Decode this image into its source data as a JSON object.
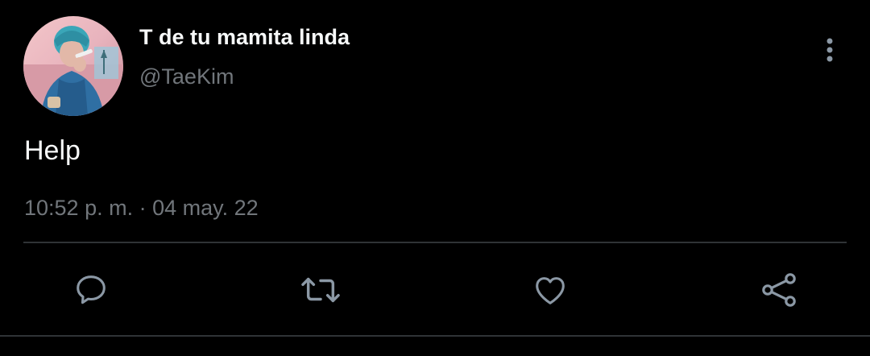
{
  "tweet": {
    "author": {
      "display_name": "T de tu mamita linda",
      "handle": "@TaeKim",
      "avatar": "profile-photo-avatar"
    },
    "text": "Help",
    "timestamp": "10:52 p. m. · 04 may. 22"
  },
  "actions": [
    {
      "name": "reply",
      "icon": "comment-bubble-icon"
    },
    {
      "name": "retweet",
      "icon": "retweet-arrows-icon"
    },
    {
      "name": "like",
      "icon": "heart-icon"
    },
    {
      "name": "share",
      "icon": "share-nodes-icon"
    }
  ],
  "menu": {
    "icon": "vertical-ellipsis-icon"
  },
  "colors": {
    "background": "#000000",
    "primary_text": "#f7f9f9",
    "secondary_text": "#71767b",
    "divider": "#2f3336",
    "icon": "#8b98a5"
  }
}
